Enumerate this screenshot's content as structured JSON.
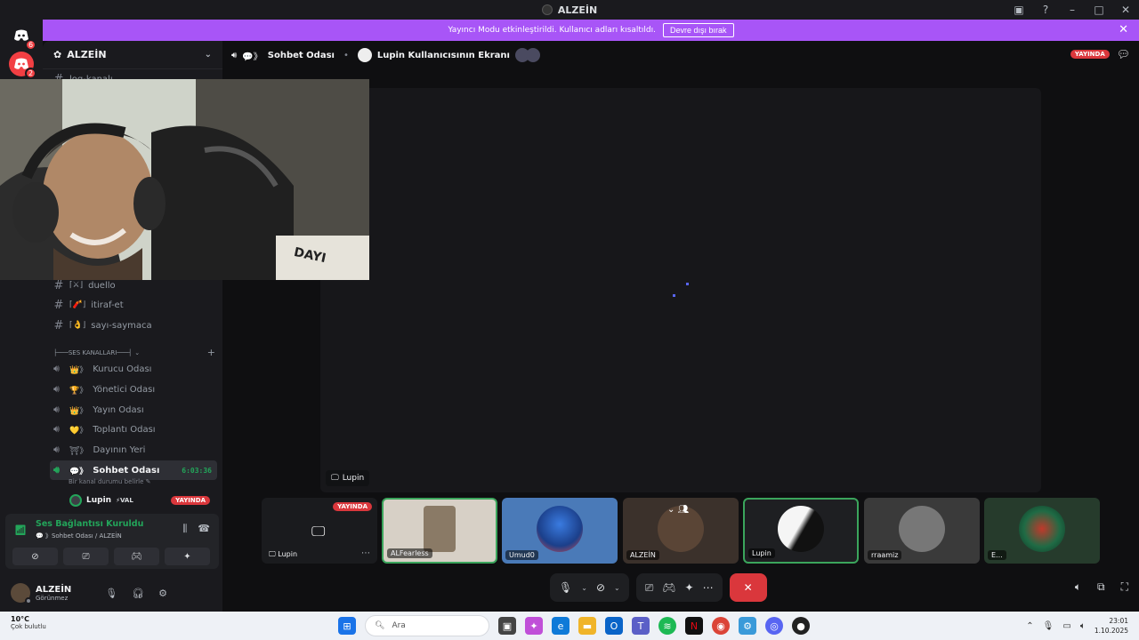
{
  "window": {
    "title": "ALZEİN"
  },
  "rail": {
    "badge_top": "6",
    "badge_second": "2"
  },
  "banner": {
    "message": "Yayıncı Modu etkinleştirildi. Kullanıcı adları kısaltıldı.",
    "button": "Devre dışı bırak"
  },
  "server": {
    "name": "ALZEİN"
  },
  "channels": {
    "top_partial": "log-kanalı",
    "text": [
      {
        "emoji": "⚔",
        "name": "duello"
      },
      {
        "emoji": "🧨",
        "name": "itiraf-et"
      },
      {
        "emoji": "👌",
        "name": "sayı-saymaca"
      }
    ],
    "voice_category": "├───SES KANALLARI───┤",
    "voice": [
      {
        "emoji": "👑",
        "name": "Kurucu Odası"
      },
      {
        "emoji": "🏆",
        "name": "Yönetici Odası"
      },
      {
        "emoji": "👑",
        "name": "Yayın Odası"
      },
      {
        "emoji": "💛",
        "name": "Toplantı Odası"
      },
      {
        "emoji": "⛩",
        "name": "Dayının Yeri"
      }
    ],
    "active": {
      "emoji": "💬",
      "name": "Sohbet Odası",
      "timer": "6:03:36",
      "note": "Bir kanal durumu belirle"
    },
    "member": {
      "name": "Lupin",
      "tag": "⚡VAL",
      "live": "YAYINDA"
    }
  },
  "voice_panel": {
    "status": "Ses Bağlantısı Kuruldu",
    "sub": "Sohbet Odası / ALZEİN"
  },
  "user": {
    "name": "ALZEİN",
    "state": "Görünmez"
  },
  "header": {
    "channel": "Sohbet Odası",
    "screen": "Lupin Kullanıcısının Ekranı",
    "live": "YAYINDA"
  },
  "stream": {
    "label": "Lupin"
  },
  "tiles": [
    {
      "name": "Lupin",
      "live": "YAYINDA"
    },
    {
      "name": "ALFearless"
    },
    {
      "name": "Umud0"
    },
    {
      "name": "ALZEİN"
    },
    {
      "name": "Lupin"
    },
    {
      "name": "rraamiz"
    },
    {
      "name": "E..."
    }
  ],
  "taskbar": {
    "weather_temp": "10°C",
    "weather_text": "Çok bulutlu",
    "search": "Ara",
    "time": "23:01",
    "date": "1.10.2025"
  }
}
